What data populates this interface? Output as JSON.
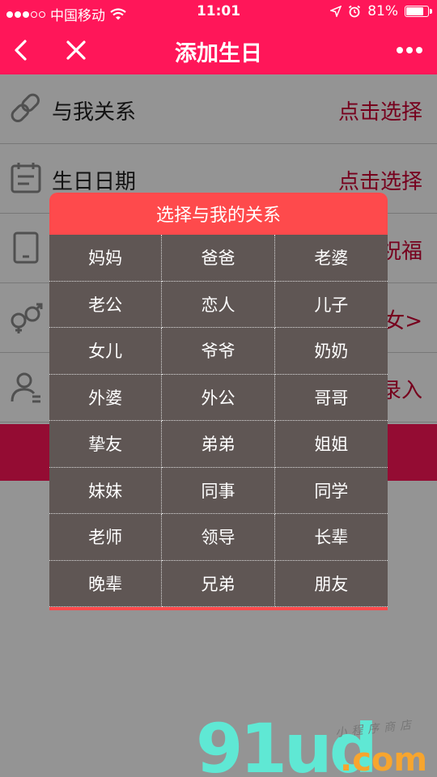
{
  "status_bar": {
    "carrier": "中国移动",
    "time": "11:01",
    "battery_percent": "81%",
    "battery_level": 0.81
  },
  "nav": {
    "title": "添加生日"
  },
  "form": {
    "rows": [
      {
        "label": "与我关系",
        "value": "点击选择",
        "icon": "link-icon"
      },
      {
        "label": "生日日期",
        "value": "点击选择",
        "icon": "calendar-icon"
      },
      {
        "label": "",
        "value": "祝福",
        "icon": "phone-icon"
      },
      {
        "label": "",
        "value": "女>",
        "icon": "gender-icon"
      },
      {
        "label": "",
        "value": "录入",
        "icon": "user-icon"
      }
    ]
  },
  "picker": {
    "title": "选择与我的关系",
    "options": [
      "妈妈",
      "爸爸",
      "老婆",
      "老公",
      "恋人",
      "儿子",
      "女儿",
      "爷爷",
      "奶奶",
      "外婆",
      "外公",
      "哥哥",
      "挚友",
      "弟弟",
      "姐姐",
      "妹妹",
      "同事",
      "同学",
      "老师",
      "领导",
      "长辈",
      "晚辈",
      "兄弟",
      "朋友"
    ]
  },
  "watermark": {
    "logo": "91ud",
    "suffix": ".com",
    "tagline": "小程序商店"
  },
  "colors": {
    "brand": "#ff1659",
    "picker_header": "#fe4a4c",
    "picker_body": "#5f5654",
    "value_text": "#cc0033"
  }
}
